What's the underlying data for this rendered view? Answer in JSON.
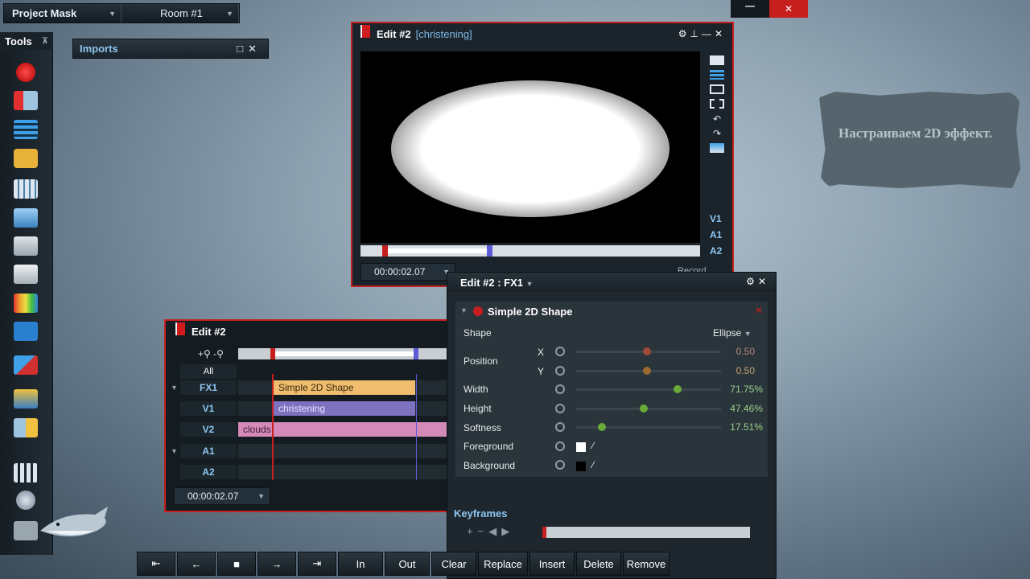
{
  "top_bar": {
    "project": "Project Mask",
    "room": "Room #1"
  },
  "tools": {
    "title": "Tools",
    "pin": "⊼"
  },
  "imports": {
    "title": "Imports"
  },
  "edit_window": {
    "title": "Edit #2",
    "subtitle": "[christening]",
    "timecode": "00:00:02.07",
    "right_text": "Record",
    "channels": [
      "V1",
      "A1",
      "A2"
    ]
  },
  "timeline": {
    "title": "Edit #2",
    "all": "All",
    "tracks": [
      "FX1",
      "V1",
      "V2",
      "A1",
      "A2"
    ],
    "clips": {
      "fx": "Simple 2D Shape",
      "v1": "christening",
      "v2": "clouds"
    },
    "timecode": "00:00:02.07"
  },
  "fx": {
    "title": "Edit #2 : FX1",
    "effect": "Simple 2D Shape",
    "shape_label": "Shape",
    "shape_value": "Ellipse",
    "position_label": "Position",
    "x_label": "X",
    "y_label": "Y",
    "x_value": "0.50",
    "y_value": "0.50",
    "width_label": "Width",
    "width_value": "71.75%",
    "height_label": "Height",
    "height_value": "47.46%",
    "softness_label": "Softness",
    "softness_value": "17.51%",
    "fg_label": "Foreground",
    "bg_label": "Background",
    "keyframes": "Keyframes"
  },
  "transport": [
    "In",
    "Out",
    "Clear",
    "Replace",
    "Insert",
    "Delete",
    "Remove"
  ],
  "note": "Настраиваем 2D эффект.",
  "colors": {
    "accent_red": "#c71e1e",
    "fx_clip": "#f0bd6e",
    "v1_clip": "#7e72c0",
    "v2_clip": "#d48ab8",
    "value_green": "#9dd18c"
  }
}
